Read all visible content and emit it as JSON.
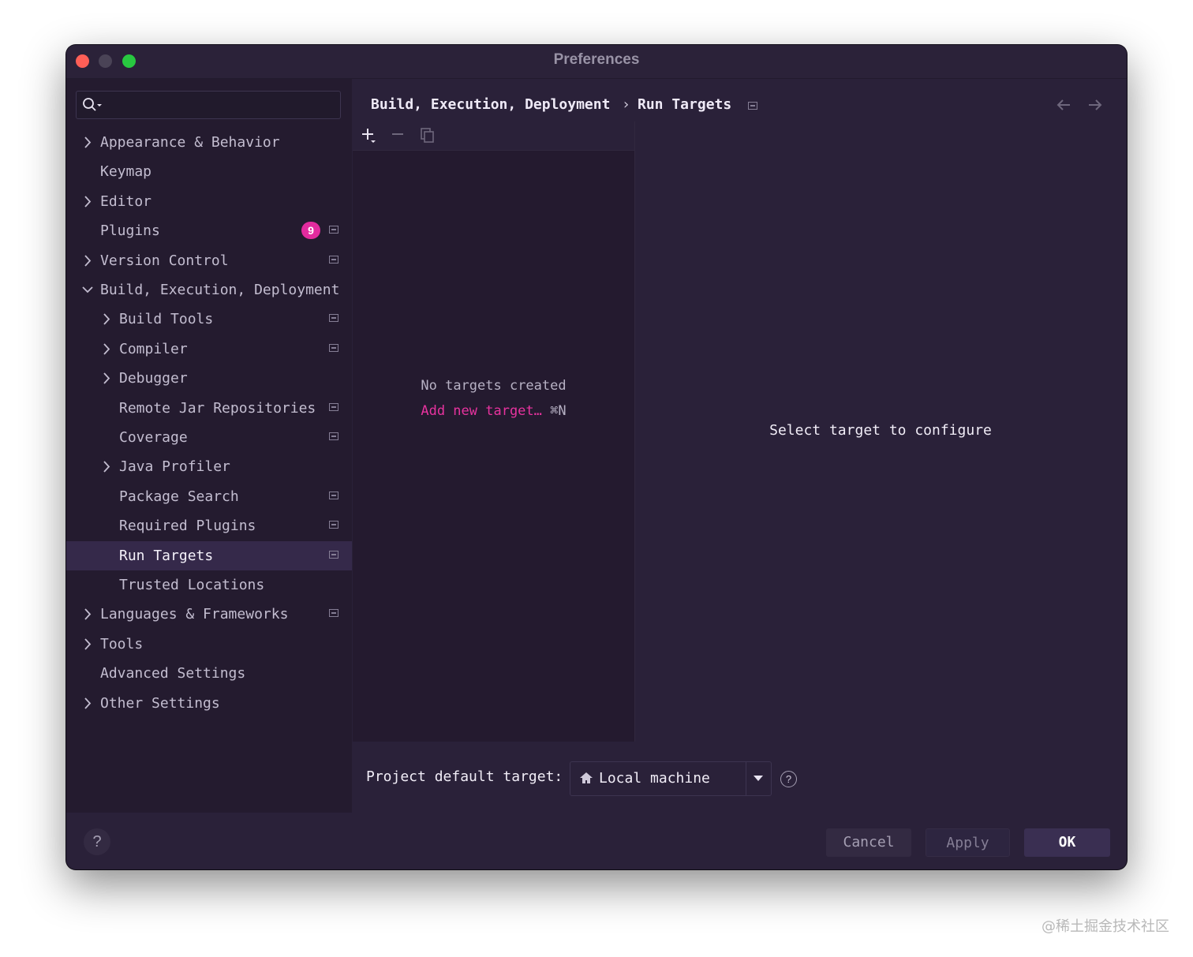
{
  "window": {
    "title": "Preferences"
  },
  "search": {
    "placeholder": "",
    "value": ""
  },
  "sidebar": {
    "items": [
      {
        "label": "Appearance & Behavior",
        "level": 0,
        "chevron": "right",
        "config_icon": false
      },
      {
        "label": "Keymap",
        "level": 0,
        "chevron": "none",
        "config_icon": false
      },
      {
        "label": "Editor",
        "level": 0,
        "chevron": "right",
        "config_icon": false
      },
      {
        "label": "Plugins",
        "level": 0,
        "chevron": "none",
        "config_icon": true,
        "badge": "9"
      },
      {
        "label": "Version Control",
        "level": 0,
        "chevron": "right",
        "config_icon": true
      },
      {
        "label": "Build, Execution, Deployment",
        "level": 0,
        "chevron": "down",
        "config_icon": false
      },
      {
        "label": "Build Tools",
        "level": 1,
        "chevron": "right",
        "config_icon": true
      },
      {
        "label": "Compiler",
        "level": 1,
        "chevron": "right",
        "config_icon": true
      },
      {
        "label": "Debugger",
        "level": 1,
        "chevron": "right",
        "config_icon": false
      },
      {
        "label": "Remote Jar Repositories",
        "level": 1,
        "chevron": "none",
        "config_icon": true
      },
      {
        "label": "Coverage",
        "level": 1,
        "chevron": "none",
        "config_icon": true
      },
      {
        "label": "Java Profiler",
        "level": 1,
        "chevron": "right",
        "config_icon": false
      },
      {
        "label": "Package Search",
        "level": 1,
        "chevron": "none",
        "config_icon": true
      },
      {
        "label": "Required Plugins",
        "level": 1,
        "chevron": "none",
        "config_icon": true
      },
      {
        "label": "Run Targets",
        "level": 1,
        "chevron": "none",
        "config_icon": true,
        "selected": true
      },
      {
        "label": "Trusted Locations",
        "level": 1,
        "chevron": "none",
        "config_icon": false
      },
      {
        "label": "Languages & Frameworks",
        "level": 0,
        "chevron": "right",
        "config_icon": true
      },
      {
        "label": "Tools",
        "level": 0,
        "chevron": "right",
        "config_icon": false
      },
      {
        "label": "Advanced Settings",
        "level": 0,
        "chevron": "none",
        "config_icon": false
      },
      {
        "label": "Other Settings",
        "level": 0,
        "chevron": "right",
        "config_icon": false
      }
    ]
  },
  "breadcrumb": {
    "parent": "Build, Execution, Deployment",
    "separator": "›",
    "current": "Run Targets"
  },
  "targets_list": {
    "empty_message": "No targets created",
    "add_link": "Add new target…",
    "add_shortcut": "⌘N",
    "toolbar_icons": [
      "add-icon",
      "remove-icon",
      "copy-icon"
    ]
  },
  "detail": {
    "placeholder_message": "Select target to configure"
  },
  "default_target": {
    "label": "Project default target:",
    "selected": "Local machine",
    "icon": "home-icon"
  },
  "buttons": {
    "cancel": "Cancel",
    "apply": "Apply",
    "ok": "OK",
    "help": "?"
  },
  "help_tooltip_icon": "?",
  "watermark": "@稀土掘金技术社区",
  "colors": {
    "window_bg": "#2a2139",
    "sidebar_bg": "#241b2f",
    "accent_link": "#e8339f",
    "badge": "#e22b9e",
    "selected_row": "#35294a"
  }
}
